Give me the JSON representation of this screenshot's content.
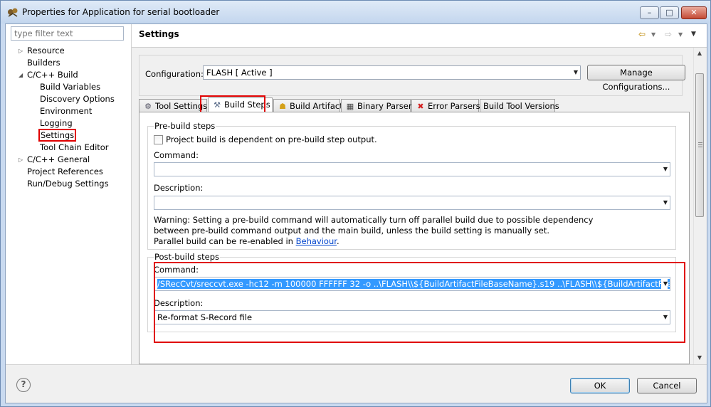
{
  "window": {
    "title": "Properties for Application for serial bootloader",
    "minimize_glyph": "–",
    "maximize_glyph": "□",
    "close_glyph": "✕"
  },
  "filter": {
    "placeholder": "type filter text"
  },
  "tree": [
    {
      "label": "Resource",
      "expandable": true
    },
    {
      "label": "Builders",
      "expandable": false
    },
    {
      "label": "C/C++ Build",
      "expandable": true,
      "expanded": true
    },
    {
      "label": "Build Variables",
      "child": true
    },
    {
      "label": "Discovery Options",
      "child": true
    },
    {
      "label": "Environment",
      "child": true
    },
    {
      "label": "Logging",
      "child": true
    },
    {
      "label": "Settings",
      "child": true,
      "selected": true
    },
    {
      "label": "Tool Chain Editor",
      "child": true
    },
    {
      "label": "C/C++ General",
      "expandable": true
    },
    {
      "label": "Project References",
      "expandable": false
    },
    {
      "label": "Run/Debug Settings",
      "expandable": false
    }
  ],
  "tree_glyphs": {
    "collapsed": "▷",
    "expanded": "◢"
  },
  "page": {
    "title": "Settings",
    "back_glyph": "⇦",
    "forward_glyph": "⇨",
    "dropdown_glyph": "▼"
  },
  "configuration": {
    "label": "Configuration:",
    "value": "FLASH  [ Active ]",
    "manage_button": "Manage Configurations..."
  },
  "tabs": [
    {
      "label": "Tool Settings",
      "icon": "⚙",
      "active": false
    },
    {
      "label": "Build Steps",
      "icon": "⚒",
      "active": true
    },
    {
      "label": "Build Artifact",
      "icon": "☗",
      "active": false
    },
    {
      "label": "Binary Parsers",
      "icon": "▦",
      "active": false
    },
    {
      "label": "Error Parsers",
      "icon": "✖",
      "active": false
    },
    {
      "label": "Build Tool Versions",
      "icon": "",
      "active": false
    }
  ],
  "pre_build": {
    "title": "Pre-build steps",
    "checkbox_label": "Project build is dependent on pre-build step output.",
    "command_label": "Command:",
    "command_value": "",
    "description_label": "Description:",
    "description_value": "",
    "warning_line1": "Warning: Setting a pre-build command will automatically turn off parallel build due to possible dependency",
    "warning_line2": "between pre-build command output and the main build, unless the build setting is manually set.",
    "warning_line3_prefix": "Parallel build can be re-enabled in ",
    "warning_link": "Behaviour",
    "warning_line3_suffix": "."
  },
  "post_build": {
    "title": "Post-build steps",
    "command_label": "Command:",
    "command_value": "/SRecCvt/sreccvt.exe -hc12 -m 100000 FFFFFF 32 -o ..\\FLASH\\\\${BuildArtifactFileBaseName}.s19 ..\\FLASH\\\\${BuildArtifactFileBaseName}.sx",
    "description_label": "Description:",
    "description_value": "Re-format S-Record file"
  },
  "buttons": {
    "ok": "OK",
    "cancel": "Cancel",
    "help_glyph": "?"
  },
  "colors": {
    "highlight": "#e00000",
    "selection": "#3399ff",
    "link": "#0044cc"
  }
}
